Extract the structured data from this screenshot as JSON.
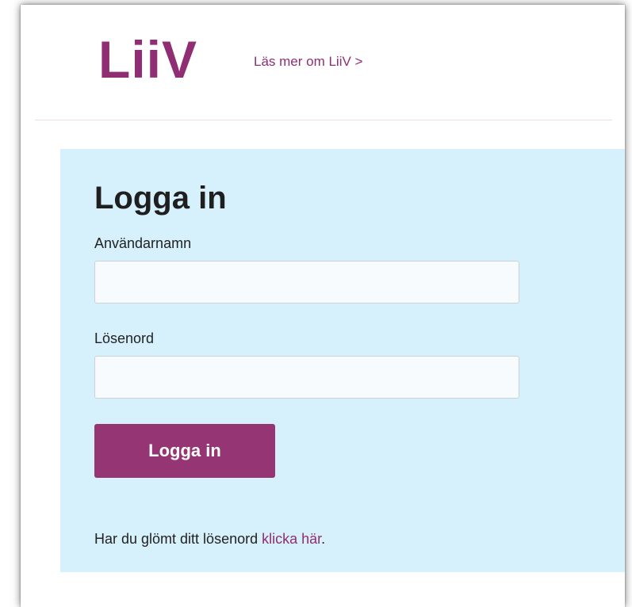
{
  "header": {
    "logo_text": "LiiV",
    "about_link": "Läs mer om LiiV >"
  },
  "login": {
    "title": "Logga in",
    "username_label": "Användarnamn",
    "username_value": "",
    "password_label": "Lösenord",
    "password_value": "",
    "submit_label": "Logga in",
    "forgot_text": "Har du glömt ditt lösenord ",
    "forgot_link": "klicka här",
    "forgot_suffix": "."
  },
  "colors": {
    "brand": "#8f2e73",
    "button_bg": "#963573",
    "panel_bg": "#d6f1fc"
  }
}
